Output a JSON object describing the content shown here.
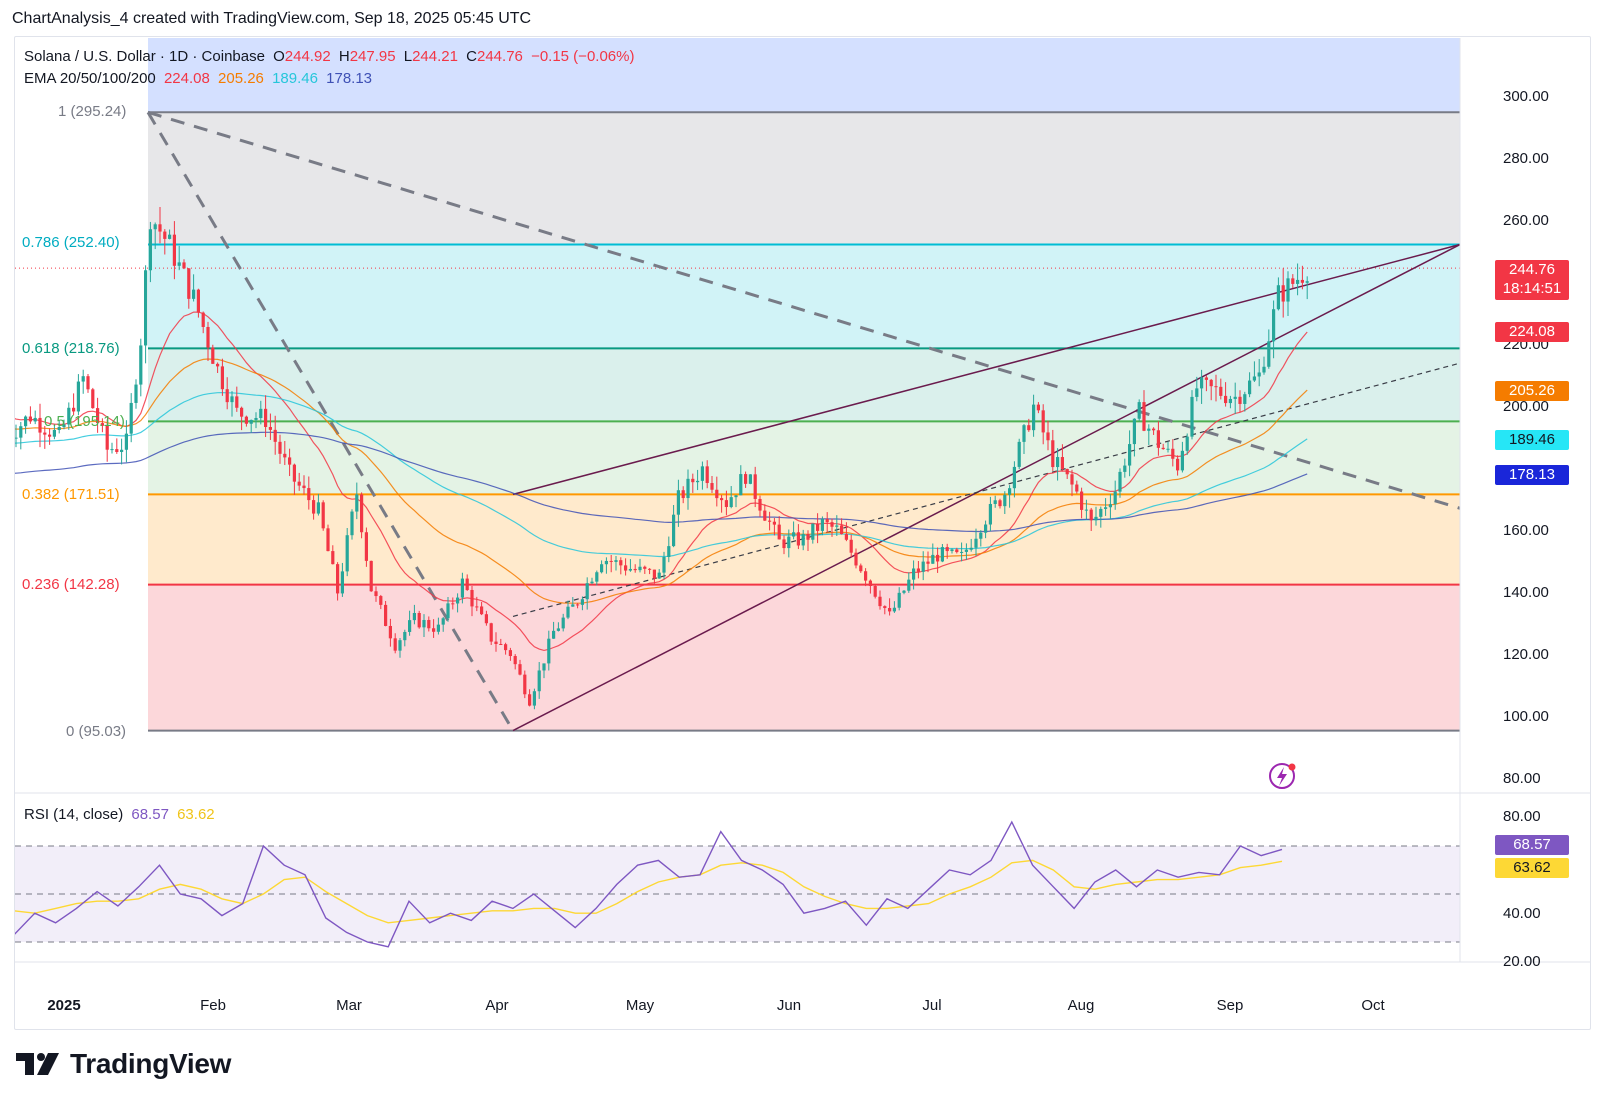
{
  "caption": "ChartAnalysis_4 created with TradingView.com, Sep 18, 2025 05:45 UTC",
  "header": {
    "symbol": "Solana / U.S. Dollar · 1D · Coinbase",
    "o_label": "O",
    "o_value": "244.92",
    "h_label": "H",
    "h_value": "247.95",
    "l_label": "L",
    "l_value": "244.21",
    "c_label": "C",
    "c_value": "244.76",
    "change": "−0.15 (−0.06%)",
    "ema_label": "EMA 20/50/100/200",
    "ema20": "224.08",
    "ema50": "205.26",
    "ema100": "189.46",
    "ema200": "178.13"
  },
  "rsi_header": {
    "label": "RSI (14, close)",
    "rsi": "68.57",
    "ma": "63.62"
  },
  "colors": {
    "up": "#26a69a",
    "down": "#f23645",
    "ema20": "#f23645",
    "ema50": "#f57c00",
    "ema100": "#26c6da",
    "ema200": "#3f51b5",
    "rsi": "#7e57c2",
    "rsi_ma": "#fdd835"
  },
  "chart_data": [
    {
      "type": "candlestick",
      "title": "Solana / U.S. Dollar · 1D · Coinbase",
      "ylim": [
        72,
        322
      ],
      "y_ticks": [
        "300.00",
        "280.00",
        "260.00",
        "220.00",
        "200.00",
        "160.00",
        "140.00",
        "120.00",
        "100.00",
        "80.00"
      ],
      "x_ticks": [
        "2025",
        "Feb",
        "Mar",
        "Apr",
        "May",
        "Jun",
        "Jul",
        "Aug",
        "Sep",
        "Oct"
      ],
      "fib_levels": [
        {
          "label": "1 (295.24)",
          "value": 295.24,
          "color": "#787b86"
        },
        {
          "label": "0.786 (252.40)",
          "value": 252.4,
          "color": "#00bcd4"
        },
        {
          "label": "0.618 (218.76)",
          "value": 218.76,
          "color": "#089981"
        },
        {
          "label": "0.5 (195.14)",
          "value": 195.14,
          "color": "#4caf50"
        },
        {
          "label": "0.382 (171.51)",
          "value": 171.51,
          "color": "#ff9800"
        },
        {
          "label": "0.236 (142.28)",
          "value": 142.28,
          "color": "#f23645"
        },
        {
          "label": "0 (95.03)",
          "value": 95.03,
          "color": "#787b86"
        }
      ],
      "last_price": {
        "value": "244.76",
        "countdown": "18:14:51"
      },
      "ema_tags": [
        "224.08",
        "205.26",
        "189.46",
        "178.13"
      ],
      "series": [
        {
          "name": "EMA 20",
          "value": 224.08
        },
        {
          "name": "EMA 50",
          "value": 205.26
        },
        {
          "name": "EMA 100",
          "value": 189.46
        },
        {
          "name": "EMA 200",
          "value": 178.13
        }
      ],
      "close_path": [
        [
          "2024-12-20",
          190
        ],
        [
          "2024-12-25",
          197
        ],
        [
          "2024-12-31",
          190
        ],
        [
          "2025-01-05",
          209
        ],
        [
          "2025-01-10",
          186
        ],
        [
          "2025-01-14",
          188
        ],
        [
          "2025-01-17",
          222
        ],
        [
          "2025-01-19",
          262
        ],
        [
          "2025-01-23",
          252
        ],
        [
          "2025-01-28",
          235
        ],
        [
          "2025-02-02",
          212
        ],
        [
          "2025-02-06",
          198
        ],
        [
          "2025-02-12",
          196
        ],
        [
          "2025-02-17",
          178
        ],
        [
          "2025-02-23",
          166
        ],
        [
          "2025-02-27",
          140
        ],
        [
          "2025-03-03",
          172
        ],
        [
          "2025-03-06",
          141
        ],
        [
          "2025-03-11",
          123
        ],
        [
          "2025-03-15",
          131
        ],
        [
          "2025-03-20",
          128
        ],
        [
          "2025-03-25",
          143
        ],
        [
          "2025-03-31",
          125
        ],
        [
          "2025-04-04",
          120
        ],
        [
          "2025-04-08",
          105
        ],
        [
          "2025-04-13",
          127
        ],
        [
          "2025-04-18",
          137
        ],
        [
          "2025-04-23",
          151
        ],
        [
          "2025-04-30",
          147
        ],
        [
          "2025-05-05",
          145
        ],
        [
          "2025-05-09",
          170
        ],
        [
          "2025-05-14",
          180
        ],
        [
          "2025-05-19",
          169
        ],
        [
          "2025-05-23",
          178
        ],
        [
          "2025-05-30",
          156
        ],
        [
          "2025-06-04",
          157
        ],
        [
          "2025-06-08",
          162
        ],
        [
          "2025-06-11",
          160
        ],
        [
          "2025-06-16",
          148
        ],
        [
          "2025-06-22",
          132
        ],
        [
          "2025-06-27",
          146
        ],
        [
          "2025-07-02",
          152
        ],
        [
          "2025-07-07",
          151
        ],
        [
          "2025-07-11",
          162
        ],
        [
          "2025-07-16",
          172
        ],
        [
          "2025-07-22",
          200
        ],
        [
          "2025-07-26",
          183
        ],
        [
          "2025-07-31",
          172
        ],
        [
          "2025-08-03",
          162
        ],
        [
          "2025-08-08",
          173
        ],
        [
          "2025-08-13",
          198
        ],
        [
          "2025-08-17",
          188
        ],
        [
          "2025-08-21",
          181
        ],
        [
          "2025-08-25",
          206
        ],
        [
          "2025-08-29",
          205
        ],
        [
          "2025-09-02",
          203
        ],
        [
          "2025-09-07",
          210
        ],
        [
          "2025-09-11",
          236
        ],
        [
          "2025-09-14",
          240
        ],
        [
          "2025-09-17",
          244.76
        ]
      ]
    },
    {
      "type": "line",
      "title": "RSI (14, close)",
      "ylim": [
        18,
        88
      ],
      "y_ticks": [
        "80.00",
        "40.00",
        "20.00"
      ],
      "bands": [
        30,
        50,
        70
      ],
      "rsi_tags": [
        "68.57",
        "63.62"
      ],
      "series": [
        {
          "name": "RSI",
          "last": 68.57,
          "values": [
            33,
            42,
            38,
            44,
            51,
            45,
            53,
            62,
            50,
            48,
            41,
            46,
            70,
            62,
            58,
            40,
            34,
            30,
            28,
            47,
            38,
            42,
            39,
            47,
            44,
            50,
            43,
            36,
            44,
            54,
            62,
            64,
            57,
            58,
            76,
            64,
            60,
            54,
            42,
            44,
            47,
            37,
            48,
            44,
            52,
            60,
            58,
            64,
            80,
            62,
            53,
            44,
            55,
            60,
            53,
            60,
            57,
            59,
            58,
            70,
            66,
            68.57
          ]
        },
        {
          "name": "RSI-based MA",
          "last": 63.62,
          "values": [
            43,
            42,
            44,
            46,
            47,
            47,
            48,
            52,
            54,
            52,
            48,
            46,
            50,
            56,
            57,
            51,
            46,
            41,
            38,
            39,
            40,
            41,
            42,
            43,
            43,
            44,
            44,
            42,
            42,
            46,
            51,
            55,
            57,
            58,
            62,
            63,
            62,
            59,
            53,
            49,
            46,
            44,
            44,
            45,
            46,
            50,
            53,
            57,
            63,
            64,
            60,
            53,
            52,
            54,
            55,
            56,
            56,
            57,
            58,
            61,
            62,
            63.62
          ]
        }
      ]
    }
  ],
  "brand": "TradingView"
}
